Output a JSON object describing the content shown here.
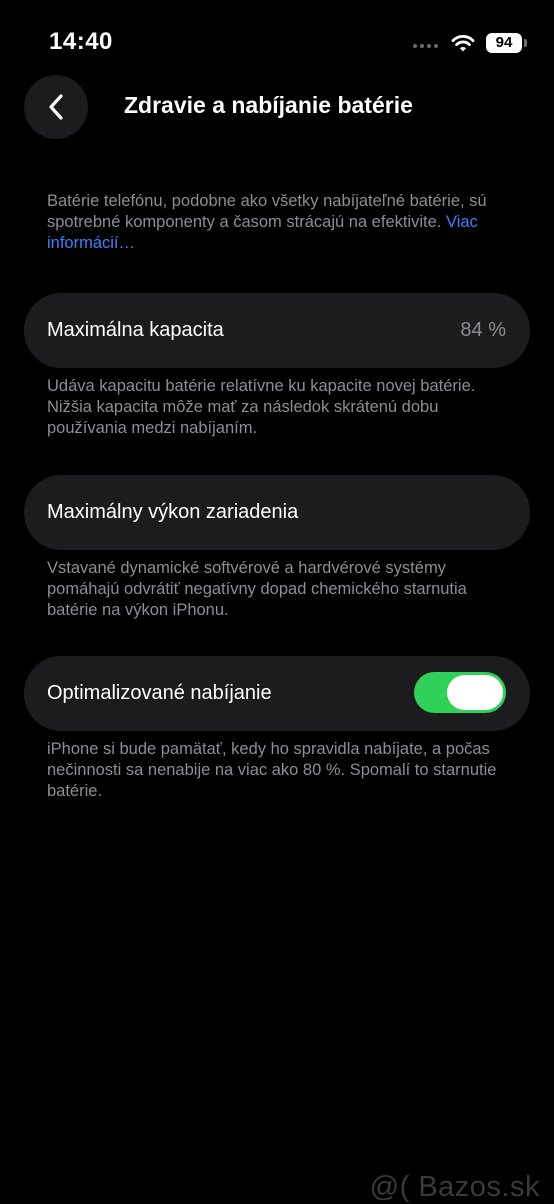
{
  "status_bar": {
    "time": "14:40",
    "battery_level": "94"
  },
  "header": {
    "title": "Zdravie a nabíjanie batérie"
  },
  "intro": {
    "text": "Batérie telefónu, podobne ako všetky nabíjateľné batérie, sú spotrebné komponenty a časom strácajú na efektivite.",
    "link": "Viac informácií…"
  },
  "capacity": {
    "label": "Maximálna kapacita",
    "value": "84 %",
    "note": "Udáva kapacitu batérie relatívne ku kapacite novej batérie. Nižšia kapacita môže mať za následok skrátenú dobu používania medzi nabíjaním."
  },
  "performance": {
    "label": "Maximálny výkon zariadenia",
    "note": "Vstavané dynamické softvérové a hardvérové systémy pomáhajú odvrátiť negatívny dopad chemického starnutia batérie na výkon iPhonu."
  },
  "optimized": {
    "label": "Optimalizované nabíjanie",
    "enabled": true,
    "note": "iPhone si bude pamätať, kedy ho spravidla nabíjate, a počas nečinnosti sa nenabije na viac ako 80 %. Spomalí to starnutie batérie."
  },
  "watermark": "@( Bazos.sk",
  "colors": {
    "accent_link": "#3b82f6",
    "toggle_on": "#30d158",
    "row_bg": "#1c1c1e",
    "secondary_text": "#8d8d93"
  },
  "icons": {
    "back": "chevron-left-icon",
    "wifi": "wifi-icon",
    "signal": "cellular-signal-icon",
    "battery": "battery-icon"
  }
}
